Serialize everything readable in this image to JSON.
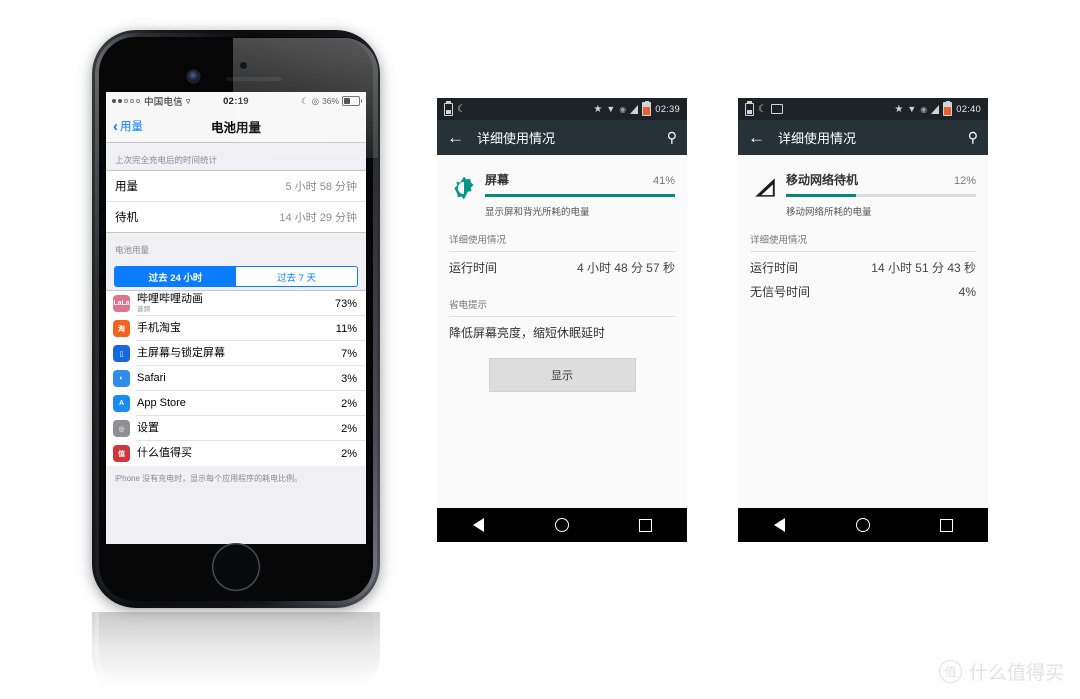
{
  "iphone": {
    "status": {
      "carrier": "中国电信",
      "wifi_icon": "wifi-icon",
      "time": "02:19",
      "moon_icon": "moon-icon",
      "lock_rotation_icon": "rotation-lock-icon",
      "battery_percent": "36%"
    },
    "nav": {
      "back_label": "用量",
      "back_icon": "chevron-left-icon",
      "title": "电池用量"
    },
    "usage_section": {
      "header": "上次完全充电后的时间统计",
      "rows": [
        {
          "label": "用量",
          "value": "5 小时 58 分钟"
        },
        {
          "label": "待机",
          "value": "14 小时 29 分钟"
        }
      ]
    },
    "battery_section": {
      "header": "电池用量",
      "segments": [
        {
          "label": "过去 24 小时",
          "active": true
        },
        {
          "label": "过去 7 天",
          "active": false
        }
      ],
      "apps": [
        {
          "name": "哔哩哔哩动画",
          "sub": "音频",
          "pct": "73%",
          "icon": "bilibili-icon",
          "color": "#e2738f",
          "glyph": "LaLa"
        },
        {
          "name": "手机淘宝",
          "sub": "",
          "pct": "11%",
          "icon": "taobao-icon",
          "color": "#f4621f",
          "glyph": "淘"
        },
        {
          "name": "主屏幕与锁定屏幕",
          "sub": "",
          "pct": "7%",
          "icon": "home-lock-screen-icon",
          "color": "#1668dc",
          "glyph": "▯"
        },
        {
          "name": "Safari",
          "sub": "",
          "pct": "3%",
          "icon": "safari-icon",
          "color": "#2f8ced",
          "glyph": "◐"
        },
        {
          "name": "App Store",
          "sub": "",
          "pct": "2%",
          "icon": "app-store-icon",
          "color": "#1a8cf0",
          "glyph": "A"
        },
        {
          "name": "设置",
          "sub": "",
          "pct": "2%",
          "icon": "settings-icon",
          "color": "#8e8e93",
          "glyph": "◎"
        },
        {
          "name": "什么值得买",
          "sub": "",
          "pct": "2%",
          "icon": "smzdm-icon",
          "color": "#d0343c",
          "glyph": "值"
        }
      ],
      "footer": "iPhone 没有充电时，显示每个应用程序的耗电比例。"
    }
  },
  "android_left": {
    "status": {
      "battery_icon": "battery-icon",
      "moon_icon": "do-not-disturb-moon-icon",
      "star_icon": "star-icon",
      "wifi_icon": "wifi-icon",
      "eye_icon": "eye-icon",
      "signal_icon": "signal-icon",
      "battery_level_icon": "battery-level-icon",
      "time": "02:39"
    },
    "toolbar": {
      "back_icon": "arrow-back-icon",
      "title": "详细使用情况",
      "search_icon": "search-icon"
    },
    "item": {
      "icon": "brightness-icon",
      "name": "屏幕",
      "percent": "41%",
      "bar_fill": 100,
      "description": "显示屏和背光所耗的电量"
    },
    "detail_header": "详细使用情况",
    "detail_rows": [
      {
        "label": "运行时间",
        "value": "4 小时 48 分 57 秒"
      }
    ],
    "tip_header": "省电提示",
    "tip_text": "降低屏幕亮度，缩短休眠延时",
    "button_label": "显示",
    "navbar": {
      "back_icon": "nav-back-icon",
      "home_icon": "nav-home-icon",
      "recents_icon": "nav-recents-icon"
    }
  },
  "android_right": {
    "status": {
      "battery_icon": "battery-icon",
      "moon_icon": "do-not-disturb-moon-icon",
      "cast_icon": "cast-icon",
      "star_icon": "star-icon",
      "wifi_icon": "wifi-icon",
      "eye_icon": "eye-icon",
      "signal_icon": "signal-icon",
      "battery_level_icon": "battery-level-icon",
      "time": "02:40"
    },
    "toolbar": {
      "back_icon": "arrow-back-icon",
      "title": "详细使用情况",
      "search_icon": "search-icon"
    },
    "item": {
      "icon": "cellular-signal-icon",
      "name": "移动网络待机",
      "percent": "12%",
      "bar_fill": 37,
      "description": "移动网络所耗的电量"
    },
    "detail_header": "详细使用情况",
    "detail_rows": [
      {
        "label": "运行时间",
        "value": "14 小时 51 分 43 秒"
      },
      {
        "label": "无信号时间",
        "value": "4%"
      }
    ],
    "navbar": {
      "back_icon": "nav-back-icon",
      "home_icon": "nav-home-icon",
      "recents_icon": "nav-recents-icon"
    }
  },
  "watermark": {
    "logo_glyph": "值",
    "text": "什么值得买"
  },
  "colors": {
    "ios_blue": "#0a7cff",
    "android_teal": "#00897b",
    "android_toolbar": "#263238",
    "ios_group_bg": "#efeff4"
  }
}
